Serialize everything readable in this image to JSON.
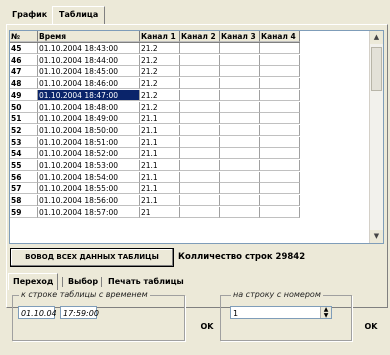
{
  "top_tabs": {
    "graph": "График",
    "table": "Таблица"
  },
  "grid": {
    "headers": [
      "№",
      "Время",
      "Канал 1",
      "Канал 2",
      "Канал 3",
      "Канал 4"
    ],
    "rows": [
      {
        "n": "45",
        "time": "01.10.2004 18:43:00",
        "ch1": "21.2",
        "selected": false
      },
      {
        "n": "46",
        "time": "01.10.2004 18:44:00",
        "ch1": "21.2",
        "selected": false
      },
      {
        "n": "47",
        "time": "01.10.2004 18:45:00",
        "ch1": "21.2",
        "selected": false
      },
      {
        "n": "48",
        "time": "01.10.2004 18:46:00",
        "ch1": "21.2",
        "selected": false
      },
      {
        "n": "49",
        "time": "01.10.2004 18:47:00",
        "ch1": "21.2",
        "selected": true
      },
      {
        "n": "50",
        "time": "01.10.2004 18:48:00",
        "ch1": "21.2",
        "selected": false
      },
      {
        "n": "51",
        "time": "01.10.2004 18:49:00",
        "ch1": "21.1",
        "selected": false
      },
      {
        "n": "52",
        "time": "01.10.2004 18:50:00",
        "ch1": "21.1",
        "selected": false
      },
      {
        "n": "53",
        "time": "01.10.2004 18:51:00",
        "ch1": "21.1",
        "selected": false
      },
      {
        "n": "54",
        "time": "01.10.2004 18:52:00",
        "ch1": "21.1",
        "selected": false
      },
      {
        "n": "55",
        "time": "01.10.2004 18:53:00",
        "ch1": "21.1",
        "selected": false
      },
      {
        "n": "56",
        "time": "01.10.2004 18:54:00",
        "ch1": "21.1",
        "selected": false
      },
      {
        "n": "57",
        "time": "01.10.2004 18:55:00",
        "ch1": "21.1",
        "selected": false
      },
      {
        "n": "58",
        "time": "01.10.2004 18:56:00",
        "ch1": "21.1",
        "selected": false
      },
      {
        "n": "59",
        "time": "01.10.2004 18:57:00",
        "ch1": "21",
        "selected": false
      }
    ]
  },
  "output_button": "ВОВОД ВСЕХ ДАННЫХ ТАБЛИЦЫ",
  "row_count": "Колличество строк 29842",
  "bottom_tabs": {
    "goto": "Переход",
    "select": "Выбор",
    "print": "Печать таблицы"
  },
  "goto_by_time": {
    "legend": "к строке таблицы с временем",
    "date": "01.10.04",
    "time": "17:59:00",
    "ok": "OK"
  },
  "goto_by_number": {
    "legend": "на строку с номером",
    "value": "1",
    "ok": "OK"
  },
  "colors": {
    "selection": "#0a246a",
    "face": "#ece9d8"
  },
  "icons": {
    "spin": "spin-updown-icon",
    "scroll_up": "scroll-up-icon",
    "scroll_down": "scroll-down-icon"
  }
}
